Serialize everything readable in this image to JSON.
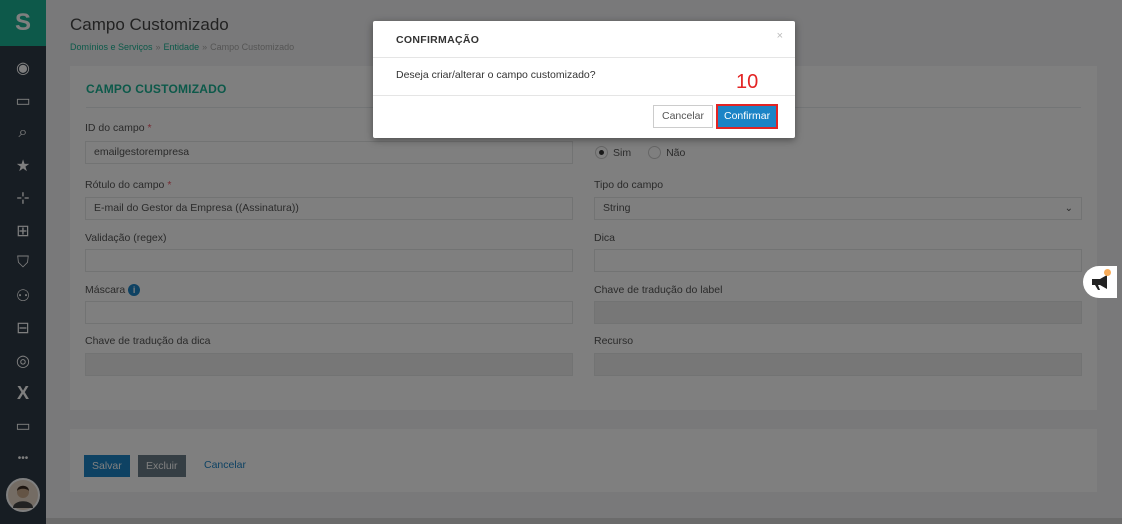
{
  "sidebar": {
    "logo_glyph": "S",
    "items": [
      {
        "icon": "user-circle-icon",
        "glyph": "◉"
      },
      {
        "icon": "notification-icon",
        "glyph": "▭"
      },
      {
        "icon": "search-icon",
        "glyph": "⌕"
      },
      {
        "icon": "star-icon",
        "glyph": "★"
      },
      {
        "icon": "sitemap-icon",
        "glyph": "⊹"
      },
      {
        "icon": "network-icon",
        "glyph": "⊞"
      },
      {
        "icon": "shield-icon",
        "glyph": "⛉"
      },
      {
        "icon": "group-icon",
        "glyph": "⚇"
      },
      {
        "icon": "lock-icon",
        "glyph": "⊟"
      },
      {
        "icon": "target-icon",
        "glyph": "◎"
      },
      {
        "icon": "x-icon",
        "glyph": "X"
      },
      {
        "icon": "monitor-icon",
        "glyph": "▭"
      },
      {
        "icon": "more-icon",
        "glyph": "•••"
      }
    ]
  },
  "header": {
    "title": "Campo Customizado",
    "breadcrumb": [
      "Domínios e Serviços",
      "Entidade",
      "Campo Customizado"
    ]
  },
  "form": {
    "section_title": "CAMPO CUSTOMIZADO",
    "id_label": "ID do campo",
    "id_value": "emailgestorempresa",
    "radio_yes": "Sim",
    "radio_no": "Não",
    "rotulo_label": "Rótulo do campo",
    "rotulo_value": "E-mail do Gestor da Empresa ((Assinatura))",
    "tipo_label": "Tipo do campo",
    "tipo_value": "String",
    "validacao_label": "Validação (regex)",
    "validacao_value": "",
    "dica_label": "Dica",
    "dica_value": "",
    "mascara_label": "Máscara",
    "mascara_value": "",
    "chave_label_label": "Chave de tradução do label",
    "chave_label_value": "",
    "chave_dica_label": "Chave de tradução da dica",
    "chave_dica_value": "",
    "recurso_label": "Recurso",
    "recurso_value": "",
    "required_mark": "*",
    "info_glyph": "i"
  },
  "actions": {
    "save": "Salvar",
    "delete": "Excluir",
    "cancel": "Cancelar"
  },
  "modal": {
    "title": "CONFIRMAÇÃO",
    "close": "×",
    "message": "Deseja criar/alterar o campo customizado?",
    "cancel": "Cancelar",
    "confirm": "Confirmar",
    "step_number": "10"
  },
  "colors": {
    "accent": "#1ab394",
    "primary": "#1c84c6",
    "highlight": "#e32424"
  }
}
